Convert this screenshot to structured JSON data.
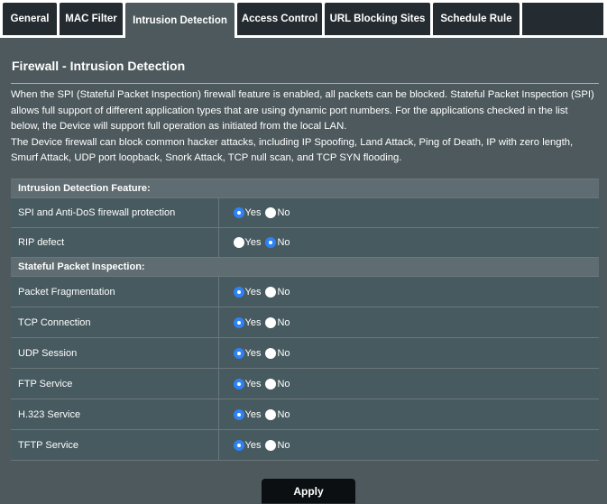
{
  "tabs": [
    {
      "label": "General",
      "active": false
    },
    {
      "label": "MAC Filter",
      "active": false
    },
    {
      "label": "Intrusion Detection",
      "active": true
    },
    {
      "label": "Access Control",
      "active": false
    },
    {
      "label": "URL Blocking Sites",
      "active": false
    },
    {
      "label": "Schedule Rule",
      "active": false
    }
  ],
  "page": {
    "title": "Firewall - Intrusion Detection",
    "desc_p1": "When the SPI (Stateful Packet Inspection) firewall feature is enabled, all packets can be blocked. Stateful Packet Inspection (SPI) allows full support of different application types that are using dynamic port numbers.  For the applications checked in the list below, the Device will support full operation as initiated from the local LAN.",
    "desc_p2": "The Device firewall can block common hacker attacks, including IP Spoofing, Land Attack, Ping of Death, IP with zero length, Smurf Attack, UDP port loopback, Snork Attack, TCP null scan, and TCP SYN flooding."
  },
  "sections": {
    "intrusion": {
      "heading": "Intrusion Detection Feature:",
      "rows": [
        {
          "label": "SPI and Anti-DoS firewall protection",
          "selected": "Yes"
        },
        {
          "label": "RIP defect",
          "selected": "No"
        }
      ]
    },
    "spi": {
      "heading": "Stateful Packet Inspection:",
      "rows": [
        {
          "label": "Packet Fragmentation",
          "selected": "Yes"
        },
        {
          "label": "TCP Connection",
          "selected": "Yes"
        },
        {
          "label": "UDP Session",
          "selected": "Yes"
        },
        {
          "label": "FTP Service",
          "selected": "Yes"
        },
        {
          "label": "H.323 Service",
          "selected": "Yes"
        },
        {
          "label": "TFTP Service",
          "selected": "Yes"
        }
      ]
    }
  },
  "radio": {
    "yes_label": "Yes",
    "no_label": "No"
  },
  "apply_label": "Apply",
  "colors": {
    "panel_bg": "#4d595d",
    "tab_bg": "#252c31",
    "radio_on": "#2e82f4",
    "button_bg": "#0c0f11"
  }
}
